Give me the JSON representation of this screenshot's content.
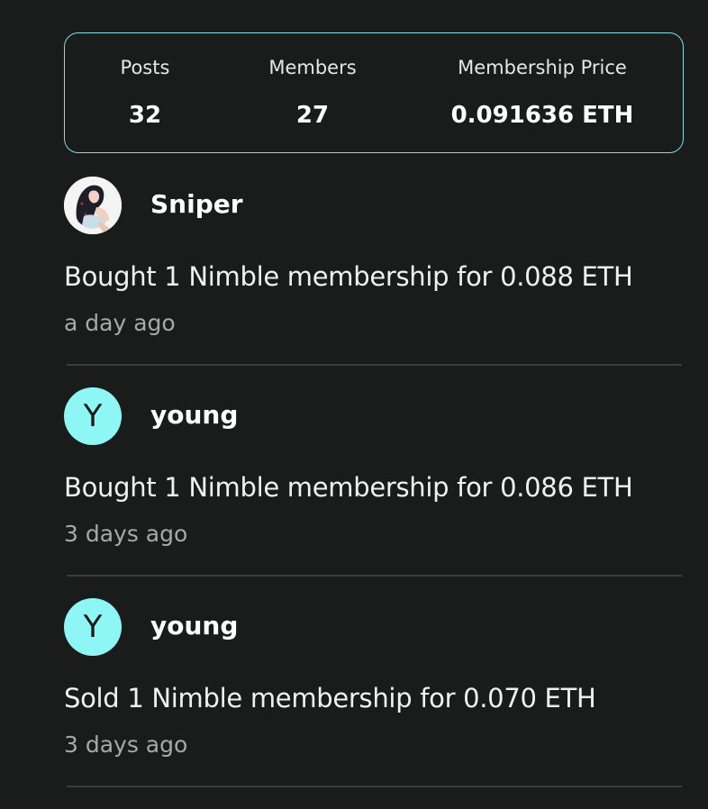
{
  "stats": {
    "posts_label": "Posts",
    "posts_value": "32",
    "members_label": "Members",
    "members_value": "27",
    "price_label": "Membership Price",
    "price_value": "0.091636 ETH"
  },
  "activities": [
    {
      "avatar_type": "photo",
      "avatar_letter": "",
      "username": "Sniper",
      "message": "Bought 1 Nimble membership for 0.088 ETH",
      "time": "a day ago"
    },
    {
      "avatar_type": "letter",
      "avatar_letter": "Y",
      "username": "young",
      "message": "Bought 1 Nimble membership for 0.086 ETH",
      "time": "3 days ago"
    },
    {
      "avatar_type": "letter",
      "avatar_letter": "Y",
      "username": "young",
      "message": "Sold 1 Nimble membership for 0.070 ETH",
      "time": "3 days ago"
    }
  ],
  "colors": {
    "background": "#1a1c1c",
    "accent": "#8ef6f4",
    "card_border": "#7fdede",
    "muted_text": "#a8a8a8"
  }
}
